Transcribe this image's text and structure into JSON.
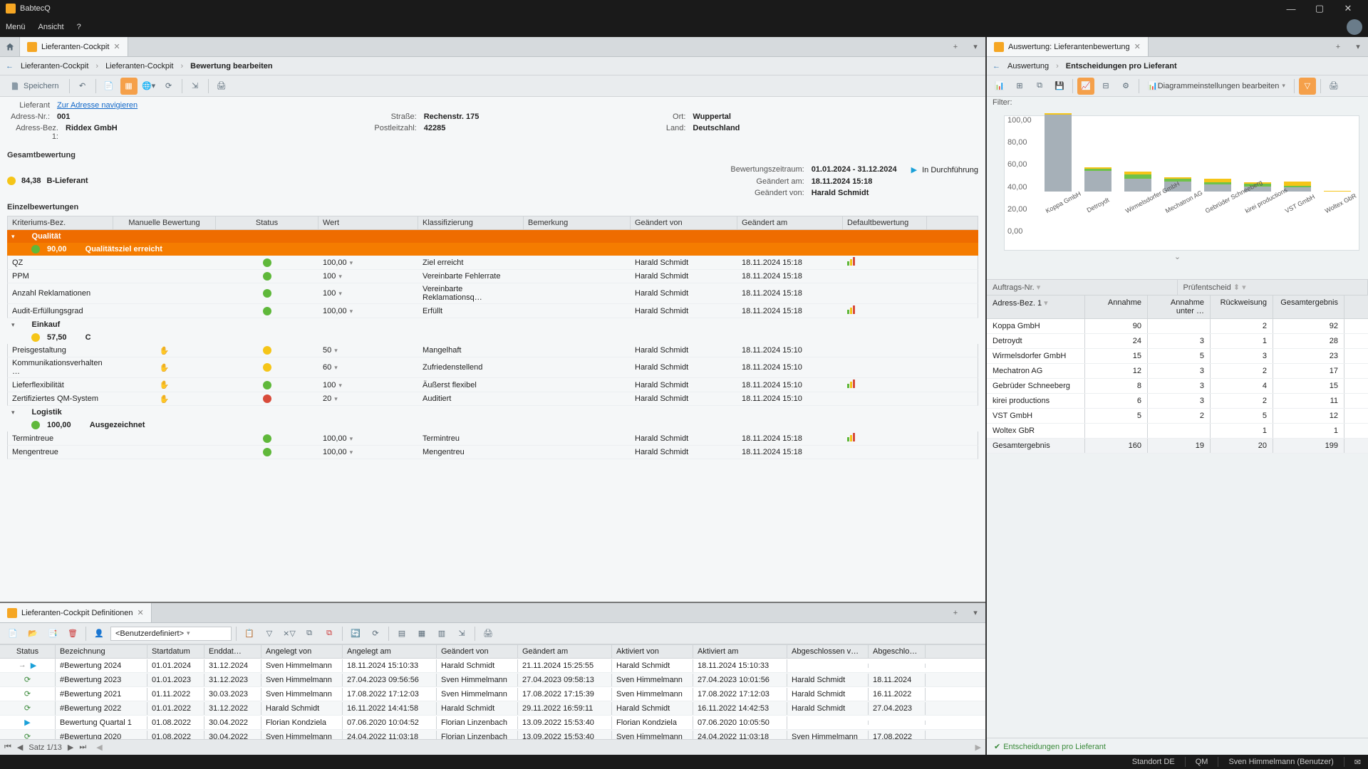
{
  "app": {
    "title": "BabtecQ"
  },
  "menu": {
    "items": [
      "Menü",
      "Ansicht",
      "?"
    ]
  },
  "window": {
    "min": "—",
    "max": "▢",
    "close": "✕"
  },
  "tabs_left": {
    "main": "Lieferanten-Cockpit"
  },
  "tabs_right": {
    "main": "Auswertung: Lieferantenbewertung"
  },
  "breadcrumb_left": [
    "Lieferanten-Cockpit",
    "Lieferanten-Cockpit",
    "Bewertung bearbeiten"
  ],
  "breadcrumb_right": [
    "Auswertung",
    "Entscheidungen pro Lieferant"
  ],
  "toolbar_left": {
    "save": "Speichern",
    "diagram_settings": "Diagrammeinstellungen bearbeiten"
  },
  "header": {
    "lieferant_lbl": "Lieferant",
    "lieferant_link": "Zur Adresse navigieren",
    "adressnr_lbl": "Adress-Nr.:",
    "adressnr": "001",
    "adressbez_lbl": "Adress-Bez. 1:",
    "adressbez": "Riddex GmbH",
    "strasse_lbl": "Straße:",
    "strasse": "Rechenstr. 175",
    "plz_lbl": "Postleitzahl:",
    "plz": "42285",
    "ort_lbl": "Ort:",
    "ort": "Wuppertal",
    "land_lbl": "Land:",
    "land": "Deutschland"
  },
  "sections": {
    "gesamt": "Gesamtbewertung",
    "einzel": "Einzelbewertungen"
  },
  "score": {
    "value": "84,38",
    "klass": "B-Lieferant",
    "zeitraum_lbl": "Bewertungszeitraum:",
    "zeitraum": "01.01.2024 - 31.12.2024",
    "status_lbl": "In Durchführung",
    "geaendert_am_lbl": "Geändert am:",
    "geaendert_am": "18.11.2024 15:18",
    "geaendert_von_lbl": "Geändert von:",
    "geaendert_von": "Harald Schmidt"
  },
  "grid_cols": [
    "Kriteriums-Bez.",
    "Manuelle Bewertung",
    "Status",
    "Wert",
    "Klassifizierung",
    "Bemerkung",
    "Geändert von",
    "Geändert am",
    "Defaultbewertung"
  ],
  "groups": [
    {
      "name": "Qualität",
      "score": "90,00",
      "note": "Qualitätsziel erreicht",
      "dot": "green",
      "rows": [
        {
          "k": "QZ",
          "man": "",
          "stat": "green",
          "wert": "100,00",
          "klass": "Ziel erreicht",
          "gv": "Harald Schmidt",
          "ga": "18.11.2024 15:18",
          "def": true
        },
        {
          "k": "PPM",
          "man": "",
          "stat": "green",
          "wert": "100",
          "klass": "Vereinbarte Fehlerrate",
          "gv": "Harald Schmidt",
          "ga": "18.11.2024 15:18",
          "def": false
        },
        {
          "k": "Anzahl Reklamationen",
          "man": "",
          "stat": "green",
          "wert": "100",
          "klass": "Vereinbarte Reklamationsq…",
          "gv": "Harald Schmidt",
          "ga": "18.11.2024 15:18",
          "def": false
        },
        {
          "k": "Audit-Erfüllungsgrad",
          "man": "",
          "stat": "green",
          "wert": "100,00",
          "klass": "Erfüllt",
          "gv": "Harald Schmidt",
          "ga": "18.11.2024 15:18",
          "def": true
        }
      ]
    },
    {
      "name": "Einkauf",
      "score": "57,50",
      "note": "C",
      "dot": "yellow",
      "rows": [
        {
          "k": "Preisgestaltung",
          "man": "hand",
          "stat": "yellow",
          "wert": "50",
          "klass": "Mangelhaft",
          "gv": "Harald Schmidt",
          "ga": "18.11.2024 15:10",
          "def": false
        },
        {
          "k": "Kommunikationsverhalten …",
          "man": "hand",
          "stat": "yellow",
          "wert": "60",
          "klass": "Zufriedenstellend",
          "gv": "Harald Schmidt",
          "ga": "18.11.2024 15:10",
          "def": false
        },
        {
          "k": "Lieferflexibilität",
          "man": "hand",
          "stat": "green",
          "wert": "100",
          "klass": "Äußerst flexibel",
          "gv": "Harald Schmidt",
          "ga": "18.11.2024 15:10",
          "def": true
        },
        {
          "k": "Zertifiziertes QM-System",
          "man": "hand",
          "stat": "red",
          "wert": "20",
          "klass": "Auditiert",
          "gv": "Harald Schmidt",
          "ga": "18.11.2024 15:10",
          "def": false
        }
      ]
    },
    {
      "name": "Logistik",
      "score": "100,00",
      "note": "Ausgezeichnet",
      "dot": "green",
      "rows": [
        {
          "k": "Termintreue",
          "man": "",
          "stat": "green",
          "wert": "100,00",
          "klass": "Termintreu",
          "gv": "Harald Schmidt",
          "ga": "18.11.2024 15:18",
          "def": true
        },
        {
          "k": "Mengentreue",
          "man": "",
          "stat": "green",
          "wert": "100,00",
          "klass": "Mengentreu",
          "gv": "Harald Schmidt",
          "ga": "18.11.2024 15:18",
          "def": false
        }
      ]
    }
  ],
  "definitions": {
    "title": "Lieferanten-Cockpit Definitionen",
    "filter_user": "<Benutzerdefiniert>",
    "cols": [
      "Status",
      "Bezeichnung",
      "Startdatum",
      "Enddat…",
      "Angelegt von",
      "Angelegt am",
      "Geändert von",
      "Geändert am",
      "Aktiviert von",
      "Aktiviert am",
      "Abgeschlossen v…",
      "Abgeschlossen …"
    ],
    "rows": [
      {
        "st": "play",
        "bez": "#Bewertung 2024",
        "sd": "01.01.2024",
        "ed": "31.12.2024",
        "av": "Sven Himmelmann",
        "aa": "18.11.2024 15:10:33",
        "gv": "Harald Schmidt",
        "ga": "21.11.2024 15:25:55",
        "actv": "Harald Schmidt",
        "acta": "18.11.2024 15:10:33",
        "abv": "",
        "aba": ""
      },
      {
        "st": "done",
        "bez": "#Bewertung 2023",
        "sd": "01.01.2023",
        "ed": "31.12.2023",
        "av": "Sven Himmelmann",
        "aa": "27.04.2023 09:56:56",
        "gv": "Sven Himmelmann",
        "ga": "27.04.2023 09:58:13",
        "actv": "Sven Himmelmann",
        "acta": "27.04.2023 10:01:56",
        "abv": "Harald Schmidt",
        "aba": "18.11.2024"
      },
      {
        "st": "done",
        "bez": "#Bewertung 2021",
        "sd": "01.11.2022",
        "ed": "30.03.2023",
        "av": "Sven Himmelmann",
        "aa": "17.08.2022 17:12:03",
        "gv": "Sven Himmelmann",
        "ga": "17.08.2022 17:15:39",
        "actv": "Sven Himmelmann",
        "acta": "17.08.2022 17:12:03",
        "abv": "Harald Schmidt",
        "aba": "16.11.2022"
      },
      {
        "st": "done",
        "bez": "#Bewertung 2022",
        "sd": "01.01.2022",
        "ed": "31.12.2022",
        "av": "Harald Schmidt",
        "aa": "16.11.2022 14:41:58",
        "gv": "Harald Schmidt",
        "ga": "29.11.2022 16:59:11",
        "actv": "Harald Schmidt",
        "acta": "16.11.2022 14:42:53",
        "abv": "Harald Schmidt",
        "aba": "27.04.2023"
      },
      {
        "st": "play",
        "bez": "Bewertung Quartal 1",
        "sd": "01.08.2022",
        "ed": "30.04.2022",
        "av": "Florian Kondziela",
        "aa": "07.06.2020 10:04:52",
        "gv": "Florian Linzenbach",
        "ga": "13.09.2022 15:53:40",
        "actv": "Florian Kondziela",
        "acta": "07.06.2020 10:05:50",
        "abv": "",
        "aba": ""
      },
      {
        "st": "done",
        "bez": "#Bewertung 2020",
        "sd": "01.08.2022",
        "ed": "30.04.2022",
        "av": "Sven Himmelmann",
        "aa": "24.04.2022 11:03:18",
        "gv": "Florian Linzenbach",
        "ga": "13.09.2022 15:53:40",
        "actv": "Sven Himmelmann",
        "acta": "24.04.2022 11:03:18",
        "abv": "Sven Himmelmann",
        "aba": "17.08.2022"
      }
    ],
    "pager": "Satz 1/13"
  },
  "right": {
    "filter_lbl": "Filter:",
    "settings": "Diagrammeinstellungen bearbeiten",
    "auf_lbl": "Auftrags-Nr.",
    "pruef_lbl": "Prüfentscheid",
    "cols": [
      "Adress-Bez. 1",
      "Annahme",
      "Annahme unter …",
      "Rückweisung",
      "Gesamtergebnis"
    ],
    "rows": [
      {
        "s": "Koppa GmbH",
        "a": "90",
        "au": "",
        "r": "2",
        "g": "92"
      },
      {
        "s": "Detroydt",
        "a": "24",
        "au": "3",
        "r": "1",
        "g": "28"
      },
      {
        "s": "Wirmelsdorfer GmbH",
        "a": "15",
        "au": "5",
        "r": "3",
        "g": "23"
      },
      {
        "s": "Mechatron AG",
        "a": "12",
        "au": "3",
        "r": "2",
        "g": "17"
      },
      {
        "s": "Gebrüder Schneeberg",
        "a": "8",
        "au": "3",
        "r": "4",
        "g": "15"
      },
      {
        "s": "kirei productions",
        "a": "6",
        "au": "3",
        "r": "2",
        "g": "11"
      },
      {
        "s": "VST GmbH",
        "a": "5",
        "au": "2",
        "r": "5",
        "g": "12"
      },
      {
        "s": "Woltex GbR",
        "a": "",
        "au": "",
        "r": "1",
        "g": "1"
      },
      {
        "s": "Gesamtergebnis",
        "a": "160",
        "au": "19",
        "r": "20",
        "g": "199"
      }
    ],
    "footer": "Entscheidungen pro Lieferant"
  },
  "chart_data": {
    "type": "bar",
    "title": "",
    "ylim": [
      0,
      100
    ],
    "yticks": [
      "100,00",
      "80,00",
      "60,00",
      "40,00",
      "20,00",
      "0,00"
    ],
    "categories": [
      "Koppa GmbH",
      "Detroydt",
      "Wirmelsdorfer GmbH",
      "Mechatron AG",
      "Gebrüder Schneeberg",
      "kirei productions",
      "VST GmbH",
      "Woltex GbR"
    ],
    "series": [
      {
        "name": "Annahme",
        "values": [
          90,
          24,
          15,
          12,
          8,
          6,
          5,
          0
        ],
        "color": "#a6b0b8"
      },
      {
        "name": "Annahme unter …",
        "values": [
          0,
          3,
          5,
          3,
          3,
          3,
          2,
          0
        ],
        "color": "#6fc24a"
      },
      {
        "name": "Rückweisung",
        "values": [
          2,
          1,
          3,
          2,
          4,
          2,
          5,
          1
        ],
        "color": "#f5c518"
      }
    ]
  },
  "statusbar": {
    "site": "Standort DE",
    "mod": "QM",
    "user": "Sven Himmelmann (Benutzer)"
  }
}
